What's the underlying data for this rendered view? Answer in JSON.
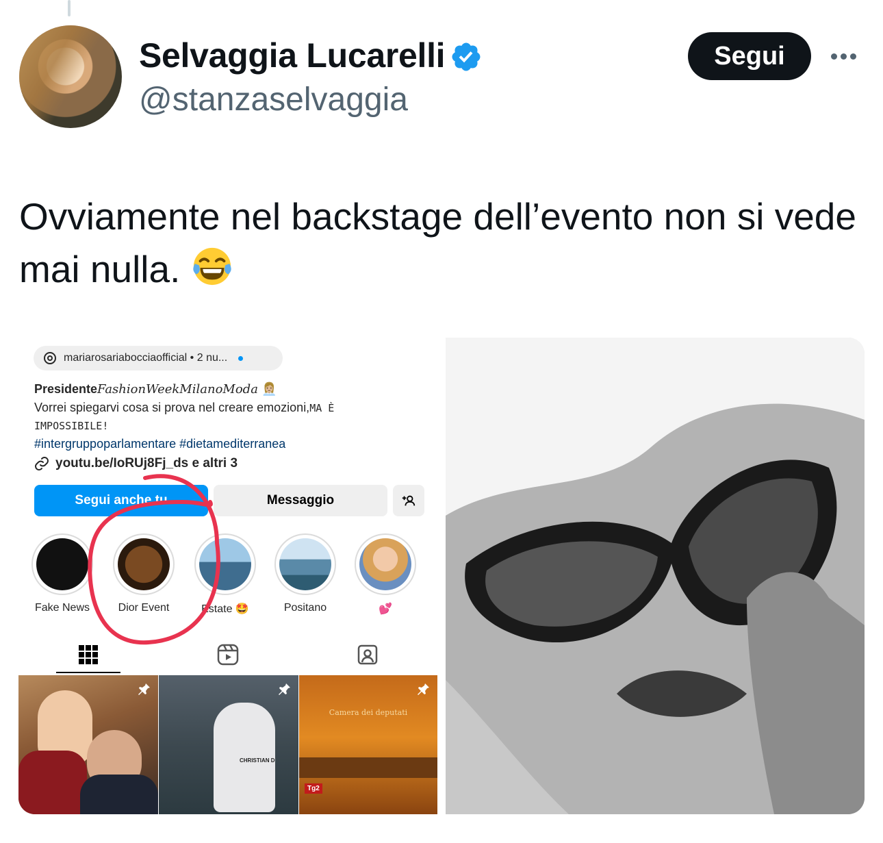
{
  "tweet": {
    "author_name": "Selvaggia Lucarelli",
    "author_handle": "@stanzaselvaggia",
    "follow_label": "Segui",
    "text": "Ovviamente nel backstage dell’evento non si vede mai nulla.",
    "emoji": "face-with-tears-of-joy",
    "colors": {
      "verified": "#1d9bf0",
      "follow_bg": "#0f1419",
      "secondary": "#536471"
    }
  },
  "media_left": {
    "threads_pill": "mariarosariabocciaofficial • 2 nu...",
    "bio_title_bold": "Presidente",
    "bio_title_script": "FashionWeekMilanoModa",
    "bio_line2": "Vorrei spiegarvi cosa si prova nel creare emozioni,",
    "bio_line2_caps": "MA È",
    "bio_line3_caps": "IMPOSSIBILE!",
    "bio_tags": "#intergruppoparlamentare #dietamediterranea",
    "link_text": "youtu.be/IoRUj8Fj_ds e altri 3",
    "btn_follow": "Segui anche tu",
    "btn_message": "Messaggio",
    "highlights": [
      {
        "label": "Fake News"
      },
      {
        "label": "Dior Event"
      },
      {
        "label": "Estate 🤩"
      },
      {
        "label": "Positano"
      },
      {
        "label": "💕"
      }
    ],
    "grid_caption_3": "Camera dei deputati",
    "grid_caption_2": "CHRISTIAN D",
    "grid_badge_3": "Tg2"
  },
  "media_right": {
    "description_icon": "portrait-photo"
  }
}
